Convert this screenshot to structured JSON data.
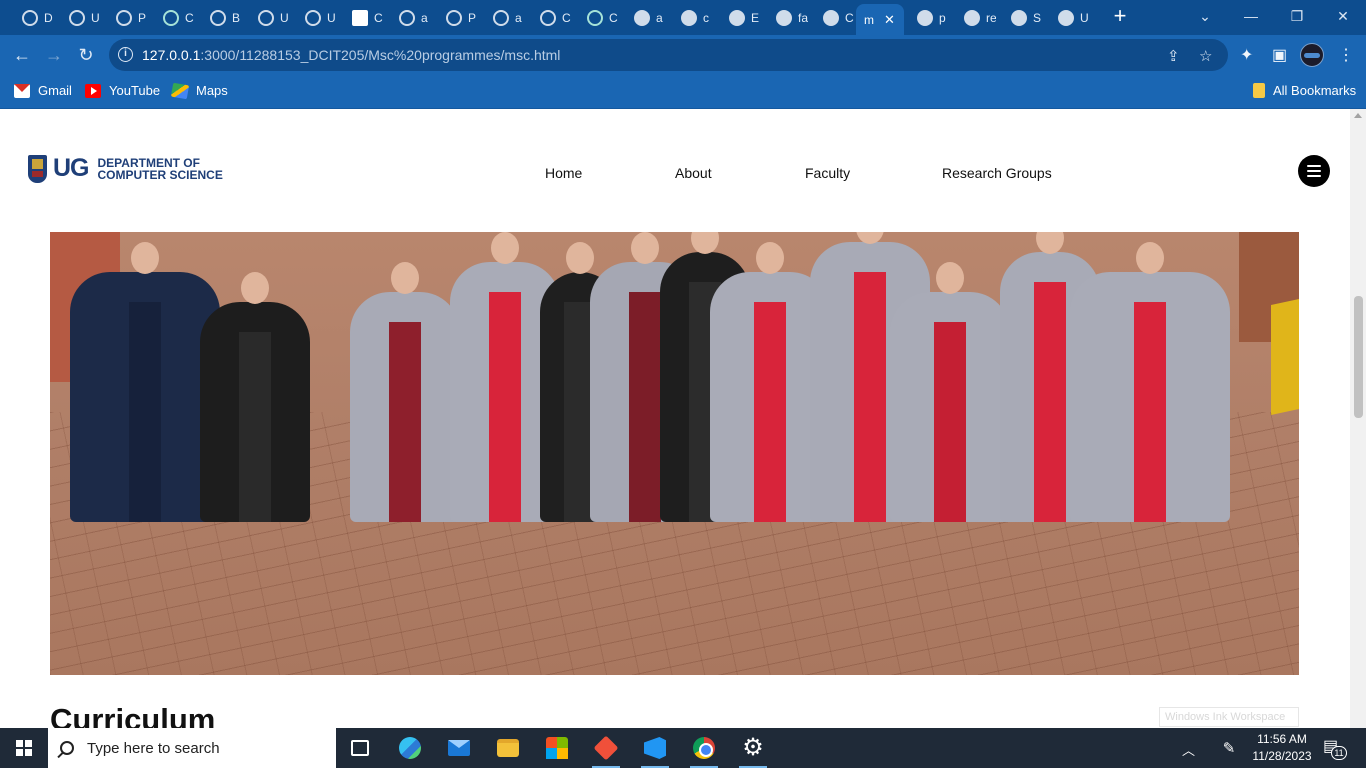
{
  "browser": {
    "tabs": [
      {
        "label": "D",
        "icon": "dashboard-icon"
      },
      {
        "label": "U",
        "icon": "globe-dotted-icon"
      },
      {
        "label": "P",
        "icon": "globe-dotted-icon"
      },
      {
        "label": "C",
        "icon": "chatgpt-icon"
      },
      {
        "label": "B",
        "icon": "site-icon"
      },
      {
        "label": "U",
        "icon": "site-icon"
      },
      {
        "label": "U",
        "icon": "site-icon"
      },
      {
        "label": "C",
        "icon": "crest-icon"
      },
      {
        "label": "a",
        "icon": "github-icon"
      },
      {
        "label": "P",
        "icon": "github-icon"
      },
      {
        "label": "a",
        "icon": "github-icon"
      },
      {
        "label": "C",
        "icon": "settings-site-icon"
      },
      {
        "label": "C",
        "icon": "chatgpt-icon"
      },
      {
        "label": "a",
        "icon": "globe-icon"
      },
      {
        "label": "c",
        "icon": "globe-icon"
      },
      {
        "label": "E",
        "icon": "globe-icon"
      },
      {
        "label": "fa",
        "icon": "globe-icon"
      },
      {
        "label": "C",
        "icon": "globe-icon"
      },
      {
        "label": "m",
        "icon": "active-page",
        "active": true
      },
      {
        "label": "p",
        "icon": "globe-icon"
      },
      {
        "label": "re",
        "icon": "globe-icon"
      },
      {
        "label": "S",
        "icon": "globe-icon"
      },
      {
        "label": "U",
        "icon": "globe-icon"
      }
    ],
    "close_glyph": "✕",
    "new_tab_glyph": "+",
    "window_controls": {
      "dropdown": "⌄",
      "minimize": "—",
      "restore": "❐",
      "close": "✕"
    },
    "url_host": "127.0.0.1",
    "url_path": ":3000/11288153_DCIT205/Msc%20programmes/msc.html",
    "bookmarks": [
      {
        "label": "Gmail",
        "icon": "gmail-icon"
      },
      {
        "label": "YouTube",
        "icon": "youtube-icon"
      },
      {
        "label": "Maps",
        "icon": "maps-icon"
      }
    ],
    "all_bookmarks": "All Bookmarks"
  },
  "site": {
    "logo_ug": "UG",
    "logo_dept_line1": "DEPARTMENT OF",
    "logo_dept_line2": "COMPUTER SCIENCE",
    "nav": [
      "Home",
      "About",
      "Faculty",
      "Research Groups"
    ],
    "hero_alt": "Graduates in academic gowns celebrating",
    "section_heading": "Curriculum",
    "ink_watermark": "Windows Ink Workspace"
  },
  "taskbar": {
    "search_placeholder": "Type here to search",
    "apps": [
      "task-view",
      "edge",
      "mail",
      "file-explorer",
      "microsoft-store",
      "git",
      "vscode",
      "chrome",
      "settings"
    ],
    "time": "11:56 AM",
    "date": "11/28/2023",
    "notification_count": "11"
  },
  "colors": {
    "chrome_frame": "#0d4d8f",
    "chrome_toolbar": "#1a66b3",
    "brand_navy": "#1f3f78",
    "gown_red": "#d8243a",
    "taskbar": "#1f2a38"
  }
}
